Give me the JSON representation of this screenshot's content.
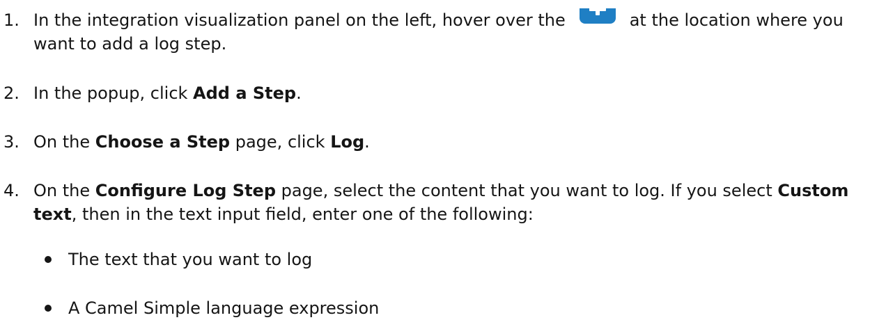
{
  "steps": [
    {
      "number": "1.",
      "line1_before": "In the integration visualization panel on the left, hover over the",
      "line1_after": "at the location where you",
      "line2": "want to add a log step."
    },
    {
      "number": "2.",
      "before": "In the popup, click ",
      "strong": "Add a Step",
      "after": "."
    },
    {
      "number": "3.",
      "before": "On the ",
      "strong1": "Choose a Step",
      "middle": " page, click ",
      "strong2": "Log",
      "after": "."
    },
    {
      "number": "4.",
      "before": "On the ",
      "strong1": "Configure Log Step",
      "middle": " page, select the content that you want to log. If you select ",
      "strong2_line1": "Custom",
      "strong2_line2": "text",
      "after_line2": ", then in the text input field, enter one of the following:"
    }
  ],
  "bullets": [
    "The text that you want to log",
    "A Camel Simple language expression"
  ],
  "icons": {
    "plus_icon": "plus-icon",
    "accent_color": "#1f7fc4"
  }
}
